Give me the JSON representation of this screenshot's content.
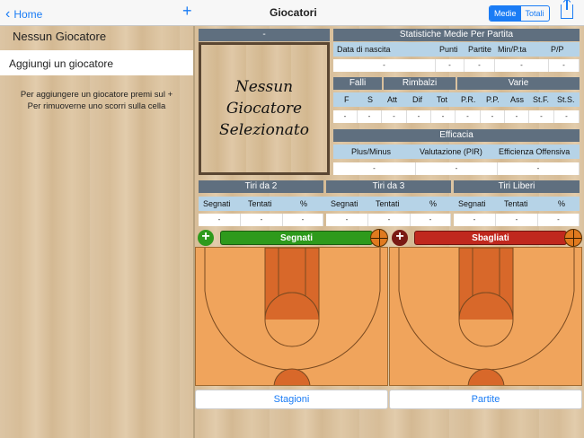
{
  "nav": {
    "back": "Home",
    "title": "Giocatori",
    "seg_medie": "Medie",
    "seg_totali": "Totali"
  },
  "left": {
    "none": "Nessun Giocatore",
    "add": "Aggiungi un giocatore",
    "hint1": "Per aggiungere un giocatore premi sul +",
    "hint2": "Per rimuoverne uno scorri sulla cella"
  },
  "photo": {
    "title_top": "-",
    "line1": "Nessun",
    "line2": "Giocatore",
    "line3": "Selezionato"
  },
  "stats": {
    "title": "Statistiche Medie Per Partita",
    "h_nascita": "Data di nascita",
    "h_punti": "Punti",
    "h_partite": "Partite",
    "h_min": "Min/P.ta",
    "h_pp": "P/P",
    "falli": "Falli",
    "rimbalzi": "Rimbalzi",
    "varie": "Varie",
    "cols": [
      "F",
      "S",
      "Att",
      "Dif",
      "Tot",
      "P.R.",
      "P.P.",
      "Ass",
      "St.F.",
      "St.S."
    ],
    "efficacia": "Efficacia",
    "plus": "Plus/Minus",
    "pir": "Valutazione (PIR)",
    "off": "Efficienza Offensiva",
    "tiri2": "Tiri da 2",
    "tiri3": "Tiri da 3",
    "liberi": "Tiri Liberi",
    "segnati": "Segnati",
    "tentati": "Tentati",
    "pct": "%",
    "dash": "-"
  },
  "buttons": {
    "segnati": "Segnati",
    "sbagliati": "Sbagliati",
    "stagioni": "Stagioni",
    "partite": "Partite"
  },
  "colors": {
    "accent": "#1a7cf5",
    "header": "#5f6f7f",
    "subheader": "#b6d3e7",
    "green": "#2e9a1c",
    "red": "#c0281e",
    "court": "#f0a45c"
  }
}
